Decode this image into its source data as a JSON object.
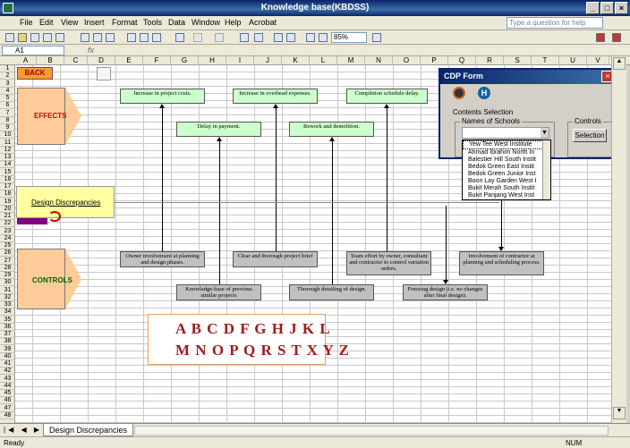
{
  "window": {
    "title": "Knowledge base(KBDSS)"
  },
  "menu": [
    "File",
    "Edit",
    "View",
    "Insert",
    "Format",
    "Tools",
    "Data",
    "Window",
    "Help",
    "Acrobat"
  ],
  "help_placeholder": "Type a question for help",
  "toolbar": {
    "zoom": "85%"
  },
  "formula": {
    "name_box": "A1",
    "fx": "fx"
  },
  "columns": [
    "A",
    "B",
    "C",
    "D",
    "E",
    "F",
    "G",
    "H",
    "I",
    "J",
    "K",
    "L",
    "M",
    "N",
    "O",
    "P",
    "Q",
    "R",
    "S",
    "T",
    "U",
    "V"
  ],
  "rows": [
    "1",
    "2",
    "3",
    "4",
    "5",
    "6",
    "7",
    "8",
    "9",
    "10",
    "11",
    "12",
    "13",
    "14",
    "15",
    "16",
    "17",
    "18",
    "19",
    "20",
    "21",
    "22",
    "23",
    "24",
    "25",
    "26",
    "27",
    "28",
    "29",
    "30",
    "31",
    "32",
    "33",
    "34",
    "35",
    "36",
    "37",
    "38",
    "39",
    "40",
    "41",
    "42",
    "43",
    "44",
    "45",
    "46",
    "47",
    "48"
  ],
  "sheet": {
    "back": "BACK",
    "effects": "EFFECTS",
    "design": "Design Discrepancies",
    "controls": "CONTROLS",
    "effects_boxes": [
      "Increase in project costs.",
      "Increase in overhead expenses.",
      "Completion schedule delay."
    ],
    "mid_boxes": [
      "Delay in payment.",
      "Rework and demolition."
    ],
    "ctrl_row1": [
      "Owner involvement at planning and design phases.",
      "Clear and thorough project brief",
      "Team effort by owner, consultant and contractor to control variation orders.",
      "Involvement of contractor at planning and scheduling process."
    ],
    "ctrl_row2": [
      "Knowledge-base of previous similar projects",
      "Thorough detailing of design.",
      "Freezing design (i.e. no changes after final design)."
    ],
    "alpha1": "A B C D F G H J K L",
    "alpha2": "M N O P Q R S T X Y Z"
  },
  "form": {
    "title": "CDP Form",
    "contents": "Contents Selection",
    "names_label": "Names of Schools",
    "controls_label": "Controls",
    "selection_btn": "Selection",
    "schools": [
      "Yew Tee West Institute",
      "Ahmad Ibrahim North In",
      "Balestier Hill South Instit",
      "Bedok Green East Instit",
      "Bedok Green Junior Inst",
      "Boon Lay Garden West I",
      "Bukit Merah South Instit",
      "Bukit Panjang West Inst"
    ]
  },
  "tab": "Design Discrepancies",
  "status": {
    "left": "Ready",
    "right": "NUM"
  }
}
